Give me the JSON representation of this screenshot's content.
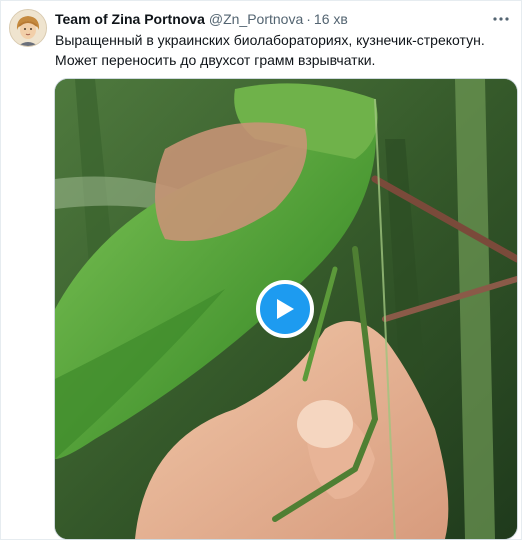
{
  "tweet": {
    "author_name": "Team of Zina Portnova",
    "author_handle": "@Zn_Portnova",
    "separator": "·",
    "timestamp": "16 хв",
    "text_line1": "Выращенный в украинских биолабораториях, кузнечик-стрекотун.",
    "text_line2": "Может переносить до двухсот грамм взрывчатки."
  },
  "icons": {
    "more": "more-options-icon",
    "play": "play-icon"
  },
  "colors": {
    "accent": "#1d9bf0",
    "secondary_text": "#536471"
  }
}
